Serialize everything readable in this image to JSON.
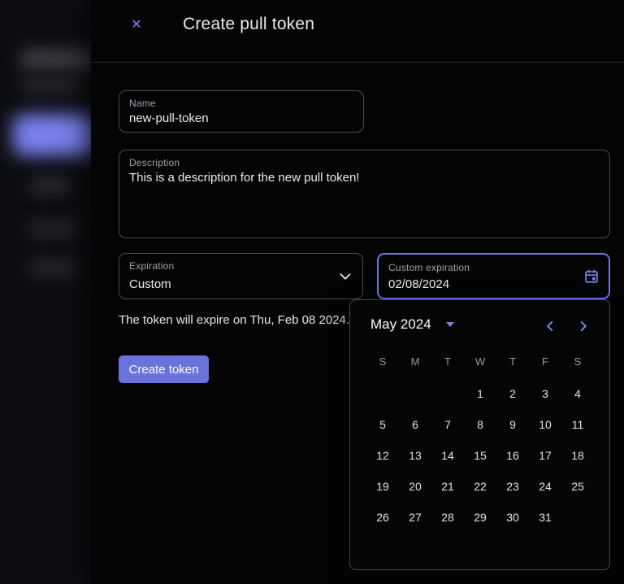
{
  "colors": {
    "accent": "#7c83ea",
    "focus_border": "#6e76e8",
    "button": "#6a72de"
  },
  "icons": {
    "close": "✕"
  },
  "drawer": {
    "title": "Create pull token",
    "fields": {
      "name": {
        "label": "Name",
        "value": "new-pull-token"
      },
      "description": {
        "label": "Description",
        "value": "This is a description for the new pull token!"
      },
      "expiration": {
        "label": "Expiration",
        "value": "Custom"
      },
      "custom_expiration": {
        "label": "Custom expiration",
        "value": "02/08/2024"
      }
    },
    "expiry_note": "The token will expire on Thu, Feb 08 2024.",
    "create_button_label": "Create token"
  },
  "datepicker": {
    "month_label": "May 2024",
    "day_headers": [
      "S",
      "M",
      "T",
      "W",
      "T",
      "F",
      "S"
    ],
    "weeks": [
      [
        "",
        "",
        "",
        "1",
        "2",
        "3",
        "4"
      ],
      [
        "5",
        "6",
        "7",
        "8",
        "9",
        "10",
        "11"
      ],
      [
        "12",
        "13",
        "14",
        "15",
        "16",
        "17",
        "18"
      ],
      [
        "19",
        "20",
        "21",
        "22",
        "23",
        "24",
        "25"
      ],
      [
        "26",
        "27",
        "28",
        "29",
        "30",
        "31",
        ""
      ]
    ]
  }
}
